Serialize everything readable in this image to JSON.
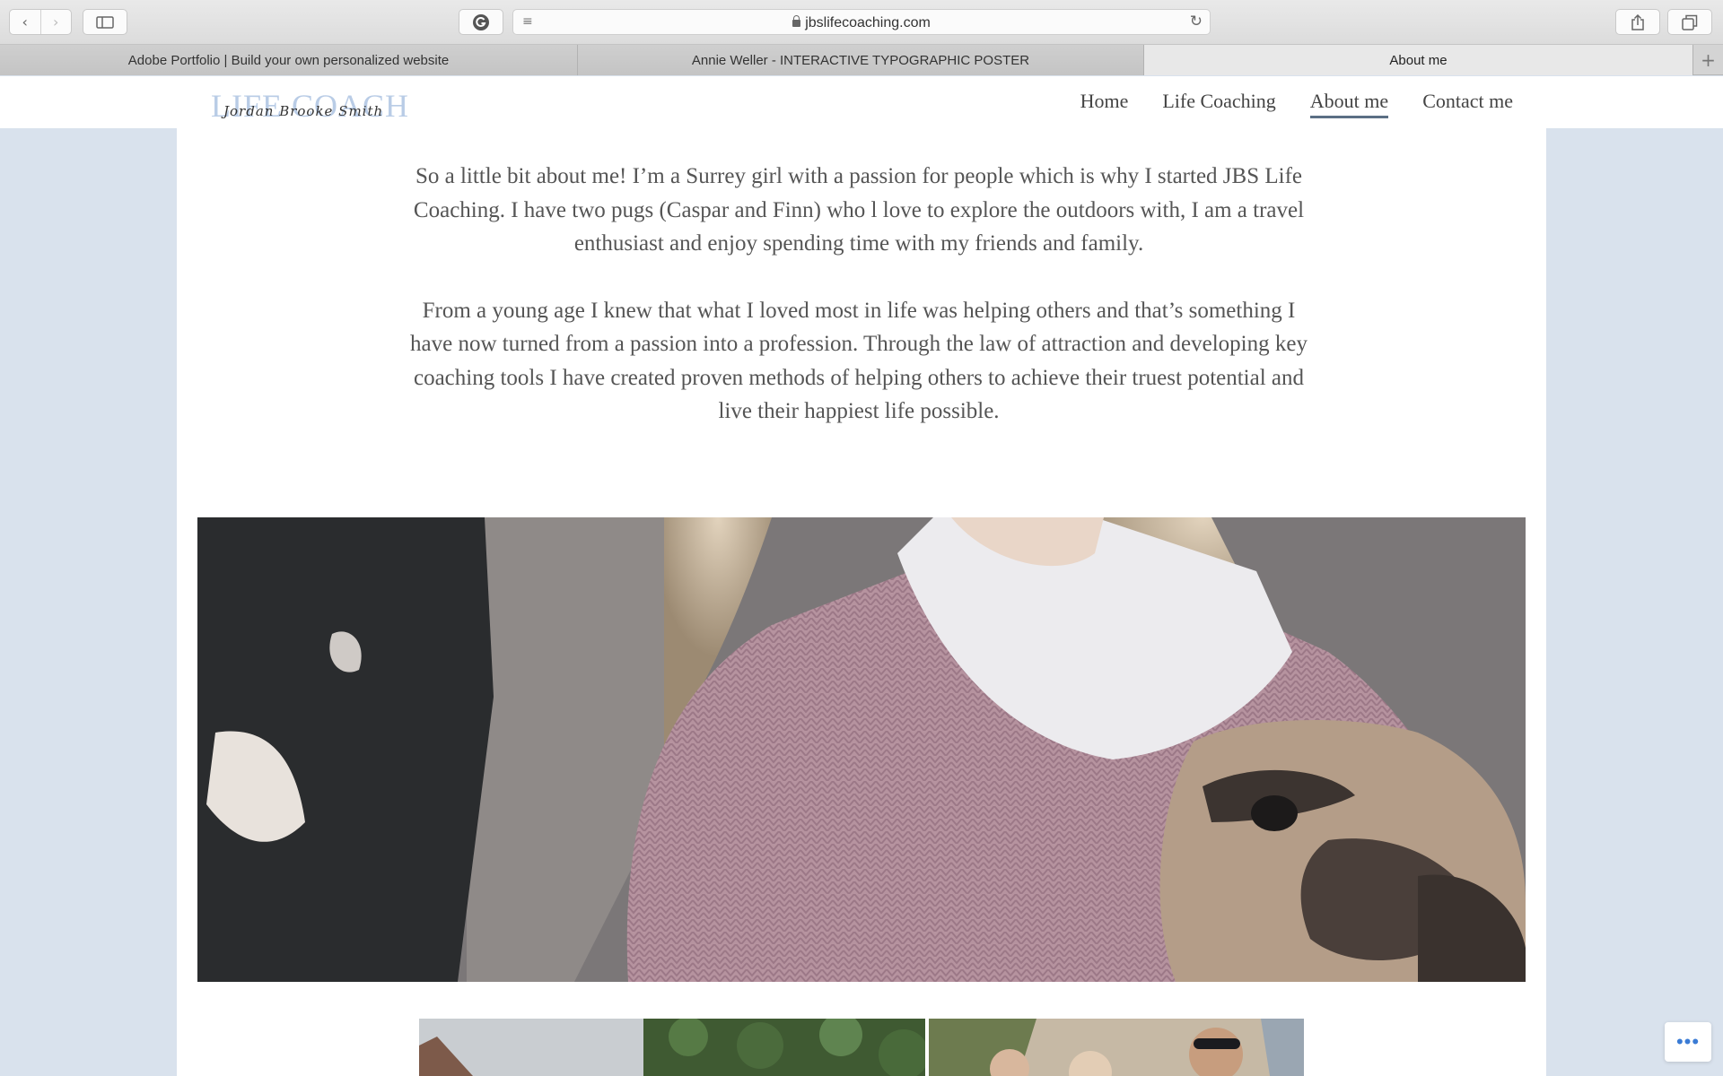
{
  "browser": {
    "url": "jbslifecoaching.com",
    "tabs": [
      {
        "label": "Adobe Portfolio | Build your own personalized website",
        "active": false
      },
      {
        "label": "Annie Weller - INTERACTIVE TYPOGRAPHIC POSTER",
        "active": false
      },
      {
        "label": "About me",
        "active": true
      }
    ],
    "new_tab_label": "+",
    "icons": {
      "back": "chevron-left-icon",
      "forward": "chevron-right-icon",
      "sidebar": "sidebar-icon",
      "extension": "grammarly-icon",
      "reader": "reader-icon",
      "lock": "lock-icon",
      "reload": "reload-icon",
      "share": "share-icon",
      "tabs": "tabs-overview-icon"
    }
  },
  "site": {
    "logo": {
      "main": "LIFE COACH",
      "script": "Jordan Brooke Smith"
    },
    "nav": [
      {
        "label": "Home",
        "current": false
      },
      {
        "label": "Life Coaching",
        "current": false
      },
      {
        "label": "About me",
        "current": true
      },
      {
        "label": "Contact me",
        "current": false
      }
    ],
    "about": {
      "paragraphs": [
        "So a little bit about me! I’m a Surrey girl with a passion for people which is why I started JBS Life Coaching. I have two pugs (Caspar and Finn) who l love to explore the outdoors with, I am a travel enthusiast and enjoy spending time with my friends and family.",
        "From a young age I knew that what I loved most in life was helping others and that’s something I have now turned from a passion into a profession. Through the law of attraction and developing key coaching tools I have created proven methods of helping others to achieve their truest potential and live their happiest life possible."
      ]
    },
    "more_button": "•••"
  },
  "colors": {
    "page_background": "#d9e2ed",
    "logo_accent": "#b9cce6",
    "nav_underline": "#5b6f84",
    "text": "#555555"
  }
}
